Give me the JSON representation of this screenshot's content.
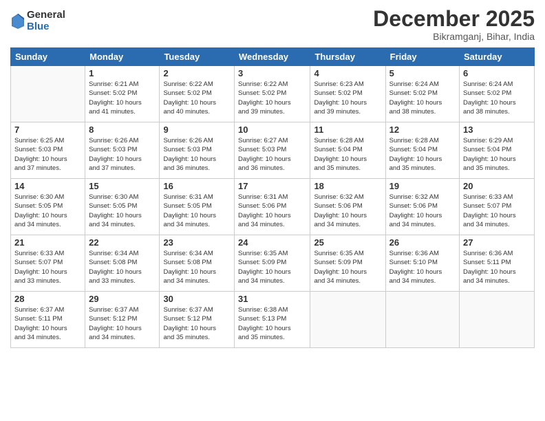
{
  "logo": {
    "general": "General",
    "blue": "Blue"
  },
  "header": {
    "month": "December 2025",
    "location": "Bikramganj, Bihar, India"
  },
  "weekdays": [
    "Sunday",
    "Monday",
    "Tuesday",
    "Wednesday",
    "Thursday",
    "Friday",
    "Saturday"
  ],
  "weeks": [
    [
      {
        "day": "",
        "info": ""
      },
      {
        "day": "1",
        "info": "Sunrise: 6:21 AM\nSunset: 5:02 PM\nDaylight: 10 hours\nand 41 minutes."
      },
      {
        "day": "2",
        "info": "Sunrise: 6:22 AM\nSunset: 5:02 PM\nDaylight: 10 hours\nand 40 minutes."
      },
      {
        "day": "3",
        "info": "Sunrise: 6:22 AM\nSunset: 5:02 PM\nDaylight: 10 hours\nand 39 minutes."
      },
      {
        "day": "4",
        "info": "Sunrise: 6:23 AM\nSunset: 5:02 PM\nDaylight: 10 hours\nand 39 minutes."
      },
      {
        "day": "5",
        "info": "Sunrise: 6:24 AM\nSunset: 5:02 PM\nDaylight: 10 hours\nand 38 minutes."
      },
      {
        "day": "6",
        "info": "Sunrise: 6:24 AM\nSunset: 5:02 PM\nDaylight: 10 hours\nand 38 minutes."
      }
    ],
    [
      {
        "day": "7",
        "info": "Sunrise: 6:25 AM\nSunset: 5:03 PM\nDaylight: 10 hours\nand 37 minutes."
      },
      {
        "day": "8",
        "info": "Sunrise: 6:26 AM\nSunset: 5:03 PM\nDaylight: 10 hours\nand 37 minutes."
      },
      {
        "day": "9",
        "info": "Sunrise: 6:26 AM\nSunset: 5:03 PM\nDaylight: 10 hours\nand 36 minutes."
      },
      {
        "day": "10",
        "info": "Sunrise: 6:27 AM\nSunset: 5:03 PM\nDaylight: 10 hours\nand 36 minutes."
      },
      {
        "day": "11",
        "info": "Sunrise: 6:28 AM\nSunset: 5:04 PM\nDaylight: 10 hours\nand 35 minutes."
      },
      {
        "day": "12",
        "info": "Sunrise: 6:28 AM\nSunset: 5:04 PM\nDaylight: 10 hours\nand 35 minutes."
      },
      {
        "day": "13",
        "info": "Sunrise: 6:29 AM\nSunset: 5:04 PM\nDaylight: 10 hours\nand 35 minutes."
      }
    ],
    [
      {
        "day": "14",
        "info": "Sunrise: 6:30 AM\nSunset: 5:05 PM\nDaylight: 10 hours\nand 34 minutes."
      },
      {
        "day": "15",
        "info": "Sunrise: 6:30 AM\nSunset: 5:05 PM\nDaylight: 10 hours\nand 34 minutes."
      },
      {
        "day": "16",
        "info": "Sunrise: 6:31 AM\nSunset: 5:05 PM\nDaylight: 10 hours\nand 34 minutes."
      },
      {
        "day": "17",
        "info": "Sunrise: 6:31 AM\nSunset: 5:06 PM\nDaylight: 10 hours\nand 34 minutes."
      },
      {
        "day": "18",
        "info": "Sunrise: 6:32 AM\nSunset: 5:06 PM\nDaylight: 10 hours\nand 34 minutes."
      },
      {
        "day": "19",
        "info": "Sunrise: 6:32 AM\nSunset: 5:06 PM\nDaylight: 10 hours\nand 34 minutes."
      },
      {
        "day": "20",
        "info": "Sunrise: 6:33 AM\nSunset: 5:07 PM\nDaylight: 10 hours\nand 34 minutes."
      }
    ],
    [
      {
        "day": "21",
        "info": "Sunrise: 6:33 AM\nSunset: 5:07 PM\nDaylight: 10 hours\nand 33 minutes."
      },
      {
        "day": "22",
        "info": "Sunrise: 6:34 AM\nSunset: 5:08 PM\nDaylight: 10 hours\nand 33 minutes."
      },
      {
        "day": "23",
        "info": "Sunrise: 6:34 AM\nSunset: 5:08 PM\nDaylight: 10 hours\nand 34 minutes."
      },
      {
        "day": "24",
        "info": "Sunrise: 6:35 AM\nSunset: 5:09 PM\nDaylight: 10 hours\nand 34 minutes."
      },
      {
        "day": "25",
        "info": "Sunrise: 6:35 AM\nSunset: 5:09 PM\nDaylight: 10 hours\nand 34 minutes."
      },
      {
        "day": "26",
        "info": "Sunrise: 6:36 AM\nSunset: 5:10 PM\nDaylight: 10 hours\nand 34 minutes."
      },
      {
        "day": "27",
        "info": "Sunrise: 6:36 AM\nSunset: 5:11 PM\nDaylight: 10 hours\nand 34 minutes."
      }
    ],
    [
      {
        "day": "28",
        "info": "Sunrise: 6:37 AM\nSunset: 5:11 PM\nDaylight: 10 hours\nand 34 minutes."
      },
      {
        "day": "29",
        "info": "Sunrise: 6:37 AM\nSunset: 5:12 PM\nDaylight: 10 hours\nand 34 minutes."
      },
      {
        "day": "30",
        "info": "Sunrise: 6:37 AM\nSunset: 5:12 PM\nDaylight: 10 hours\nand 35 minutes."
      },
      {
        "day": "31",
        "info": "Sunrise: 6:38 AM\nSunset: 5:13 PM\nDaylight: 10 hours\nand 35 minutes."
      },
      {
        "day": "",
        "info": ""
      },
      {
        "day": "",
        "info": ""
      },
      {
        "day": "",
        "info": ""
      }
    ]
  ]
}
